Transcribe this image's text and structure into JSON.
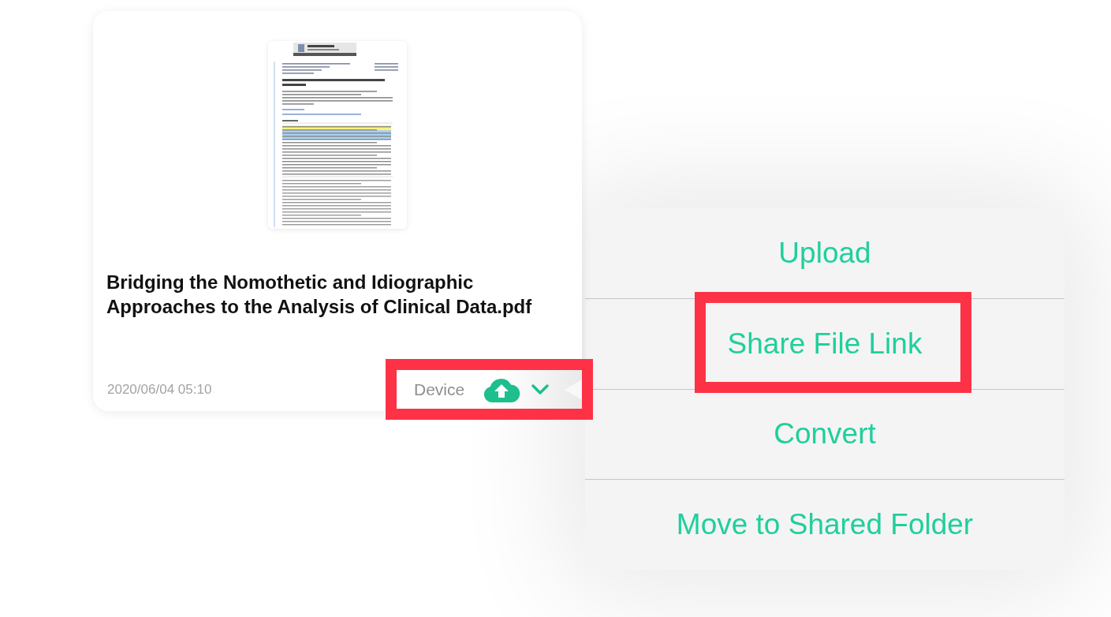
{
  "file_card": {
    "title": "Bridging the Nomothetic and Idiographic Approaches to the Analysis of Clinical Data.pdf",
    "date": "2020/06/04 05:10",
    "location": {
      "label": "Device",
      "highlighted": true
    }
  },
  "menu": {
    "items": [
      {
        "label": "Upload",
        "highlighted": false
      },
      {
        "label": "Share File Link",
        "highlighted": true
      },
      {
        "label": "Convert",
        "highlighted": false
      },
      {
        "label": "Move to Shared Folder",
        "highlighted": false
      }
    ]
  }
}
